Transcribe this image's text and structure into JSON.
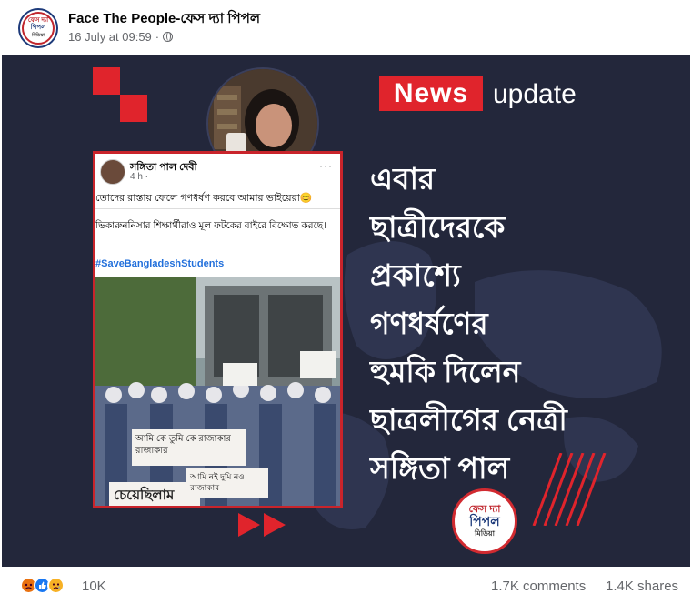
{
  "header": {
    "page_name": "Face The People-ফেস দ্যা পিপল",
    "timestamp": "16 July at 09:59",
    "separator": "·",
    "privacy_icon": "globe-icon",
    "avatar_logo": {
      "line1": "ফেস দ্যা",
      "line2": "পিপল",
      "line3": "মিডিয়া"
    }
  },
  "image": {
    "news_badge": "News",
    "news_update": "update",
    "headline_lines": [
      "এবার",
      "ছাত্রীদেরকে",
      "প্রকাশ্যে",
      "গণধর্ষণের",
      "হুমকি দিলেন",
      "ছাত্রলীগের নেত্রী",
      "সঙ্গিতা পাল"
    ],
    "card": {
      "author": "সঙ্গিতা পাল দেবী",
      "time": "4 h ·",
      "menu": "···",
      "text1": "তোদের রাস্তায় ফেলে গণধর্ষণ করবে আমার ভাইয়েরা😊",
      "text2": "ভিকারুননিসার শিক্ষার্থীরাও মূল ফটকের বাইরে বিক্ষোভ করছে।",
      "hashtag": "#SaveBangladeshStudents",
      "placard1": "আমি কে তুমি কে রাজাকার রাজাকার",
      "placard2": "আমি নই দুমি নও রাজাকার",
      "placard3": "চেয়েছিলাম"
    },
    "logo": {
      "line1": "ফেস দ্যা",
      "line2": "পিপল",
      "line3": "মিডিয়া"
    },
    "colors": {
      "accent": "#e0242c",
      "background": "#23273b"
    }
  },
  "footer": {
    "reactions": [
      "angry",
      "like",
      "sad"
    ],
    "reaction_count": "10K",
    "comments": "1.7K comments",
    "shares": "1.4K shares"
  }
}
